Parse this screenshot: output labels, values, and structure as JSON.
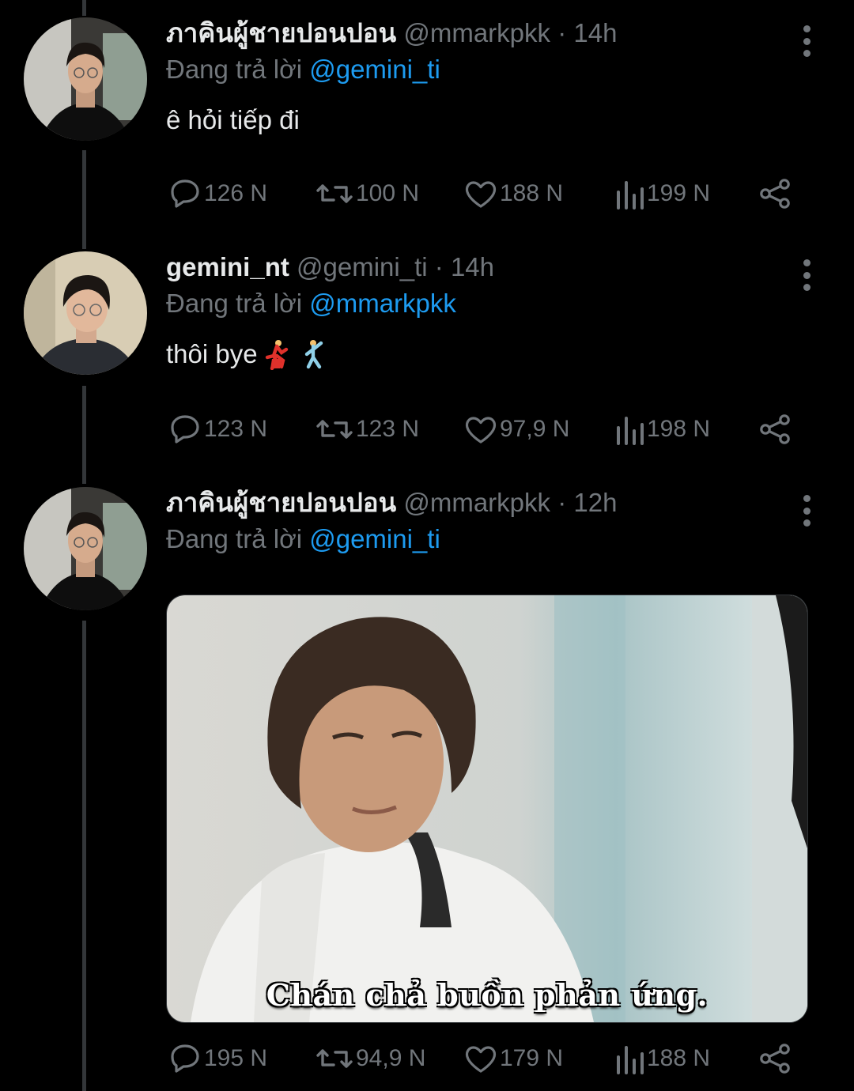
{
  "tweets": [
    {
      "name": "ภาคินผู้ชายปอนปอน",
      "handle": "@mmarkpkk",
      "dot": "·",
      "time": "14h",
      "reply_prefix": "Đang trả lời",
      "reply_to": "@gemini_ti",
      "text": "ê hỏi tiếp đi",
      "stats": {
        "replies": "126 N",
        "retweets": "100 N",
        "likes": "188 N",
        "views": "199 N"
      }
    },
    {
      "name": "gemini_nt",
      "handle": "@gemini_ti",
      "dot": "·",
      "time": "14h",
      "reply_prefix": "Đang trả lời",
      "reply_to": "@mmarkpkk",
      "text": "thôi bye",
      "emojis": [
        "dancer",
        "man-dancing"
      ],
      "stats": {
        "replies": "123 N",
        "retweets": "123 N",
        "likes": "97,9 N",
        "views": "198 N"
      }
    },
    {
      "name": "ภาคินผู้ชายปอนปอน",
      "handle": "@mmarkpkk",
      "dot": "·",
      "time": "12h",
      "reply_prefix": "Đang trả lời",
      "reply_to": "@gemini_ti",
      "media_caption": "Chán chả buồn phản ứng.",
      "stats": {
        "replies": "195 N",
        "retweets": "94,9 N",
        "likes": "179 N",
        "views": "188 N"
      }
    }
  ],
  "colors": {
    "background": "#000000",
    "text": "#e7e9ea",
    "muted": "#71767b",
    "link": "#1d9bf0",
    "thread_line": "#333639"
  },
  "icons": [
    "reply-icon",
    "retweet-icon",
    "like-icon",
    "views-icon",
    "share-icon",
    "more-icon"
  ]
}
